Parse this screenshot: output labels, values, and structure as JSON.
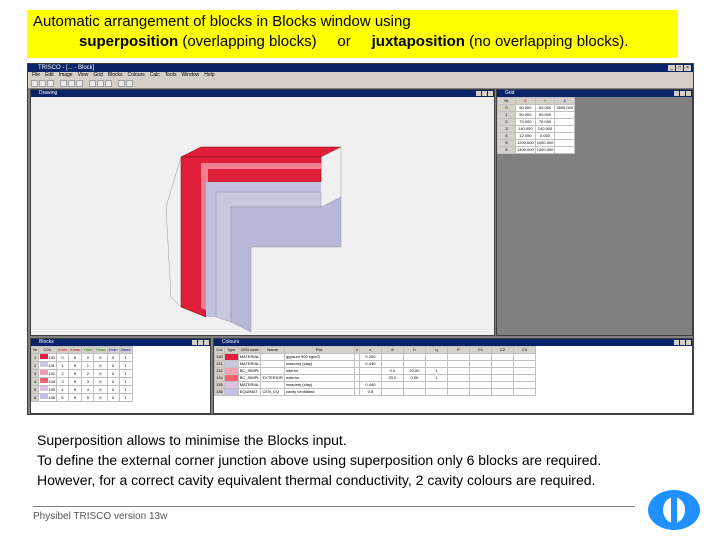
{
  "slide": {
    "title_line1": "Automatic arrangement of blocks in Blocks window using",
    "title_bold1": "superposition",
    "title_rest1": " (overlapping blocks)",
    "title_or": "or",
    "title_bold2": "juxtaposition",
    "title_rest2": " (no overlapping blocks).",
    "caption": [
      "Superposition allows to minimise the Blocks input.",
      "To define the external corner junction above using superposition only 6 blocks are required.",
      "However, for a correct cavity equivalent thermal conductivity, 2 cavity colours are required."
    ],
    "footer": "Physibel TRISCO version 13w",
    "accent": "#ffff00"
  },
  "app": {
    "title": "TRISCO - [... - Block]",
    "menu": [
      "File",
      "Edit",
      "Image",
      "View",
      "Grid",
      "Blocks",
      "Colours",
      "Calc",
      "Tools",
      "Window",
      "Help"
    ],
    "windows": {
      "drawing": "Drawing",
      "grid": "Grid",
      "blocks": "Blocks",
      "colours": "Colours"
    }
  },
  "grid_table": {
    "headers": [
      "Nr",
      "X",
      "Y",
      "Z"
    ],
    "rows": [
      [
        "0",
        "50.000",
        "50.000",
        "3500.000"
      ],
      [
        "1",
        "50.000",
        "50.000",
        ""
      ],
      [
        "2",
        "70.000",
        "70.000",
        ""
      ],
      [
        "3",
        "140.000",
        "140.000",
        ""
      ],
      [
        "4",
        "12.000",
        "0.000",
        ""
      ],
      [
        "5",
        "1200.000",
        "1000.000",
        ""
      ],
      [
        "6",
        "1400.000",
        "1200.000",
        ""
      ]
    ]
  },
  "blocks_table": {
    "headers": [
      "Nr",
      "COL",
      "Xmin",
      "Xmax",
      "Ymin",
      "Ymax",
      "Zmin",
      "Zmax"
    ],
    "rows": [
      {
        "nr": "1",
        "col": "130",
        "color": "#e0203a",
        "v": [
          "0",
          "6",
          "0",
          "6",
          "0",
          "1"
        ]
      },
      {
        "nr": "2",
        "col": "131",
        "color": "#c8c8e0",
        "v": [
          "1",
          "6",
          "1",
          "6",
          "0",
          "1"
        ]
      },
      {
        "nr": "3",
        "col": "132",
        "color": "#f0a0b0",
        "v": [
          "2",
          "6",
          "2",
          "6",
          "0",
          "1"
        ]
      },
      {
        "nr": "4",
        "col": "134",
        "color": "#ff6070",
        "v": [
          "3",
          "6",
          "3",
          "6",
          "0",
          "1"
        ]
      },
      {
        "nr": "5",
        "col": "135",
        "color": "#e0c0e0",
        "v": [
          "4",
          "6",
          "4",
          "6",
          "0",
          "1"
        ]
      },
      {
        "nr": "6",
        "col": "136",
        "color": "#c0c0e8",
        "v": [
          "5",
          "6",
          "5",
          "6",
          "0",
          "1"
        ]
      }
    ]
  },
  "colours_table": {
    "headers": [
      "Col",
      "Type",
      "CEN code",
      "Name",
      "Pat.",
      "λ",
      "ε",
      "θ",
      "h",
      "q",
      "P",
      "C1",
      "C2",
      "C3"
    ],
    "rows": [
      {
        "col": "130",
        "color": "#e0203a",
        "type": "MATERIAL",
        "cen": "",
        "name": "gypsum 900 kg/m3",
        "lambda": "0.250",
        "eps": "",
        "theta": "",
        "h": ""
      },
      {
        "col": "131",
        "color": "#c8c8e0",
        "type": "MATERIAL",
        "cen": "",
        "name": "masonry (clay)",
        "lambda": "0.440",
        "eps": "",
        "theta": "",
        "h": ""
      },
      {
        "col": "132",
        "color": "#f0a0b0",
        "type": "BC_SIMPL",
        "cen": "",
        "name": "interior",
        "lambda": "",
        "eps": "0.0",
        "theta": "20.00",
        "h": "1"
      },
      {
        "col": "134",
        "color": "#ff6070",
        "type": "BC_SIMPL",
        "cen": "EXTERIOR",
        "name": "exterior",
        "lambda": "",
        "eps": "20.0",
        "theta": "0.00",
        "h": "1"
      },
      {
        "col": "135",
        "color": "#e0c0e0",
        "type": "MATERIAL",
        "cen": "",
        "name": "masonry (clay)",
        "lambda": "0.440",
        "eps": "",
        "theta": "",
        "h": ""
      },
      {
        "col": "136",
        "color": "#c0c0e8",
        "type": "EQUIMAT",
        "cen": "CEN_EQ",
        "name": "cavity ventilated",
        "lambda": "0.5",
        "eps": "",
        "theta": "",
        "h": ""
      }
    ]
  }
}
